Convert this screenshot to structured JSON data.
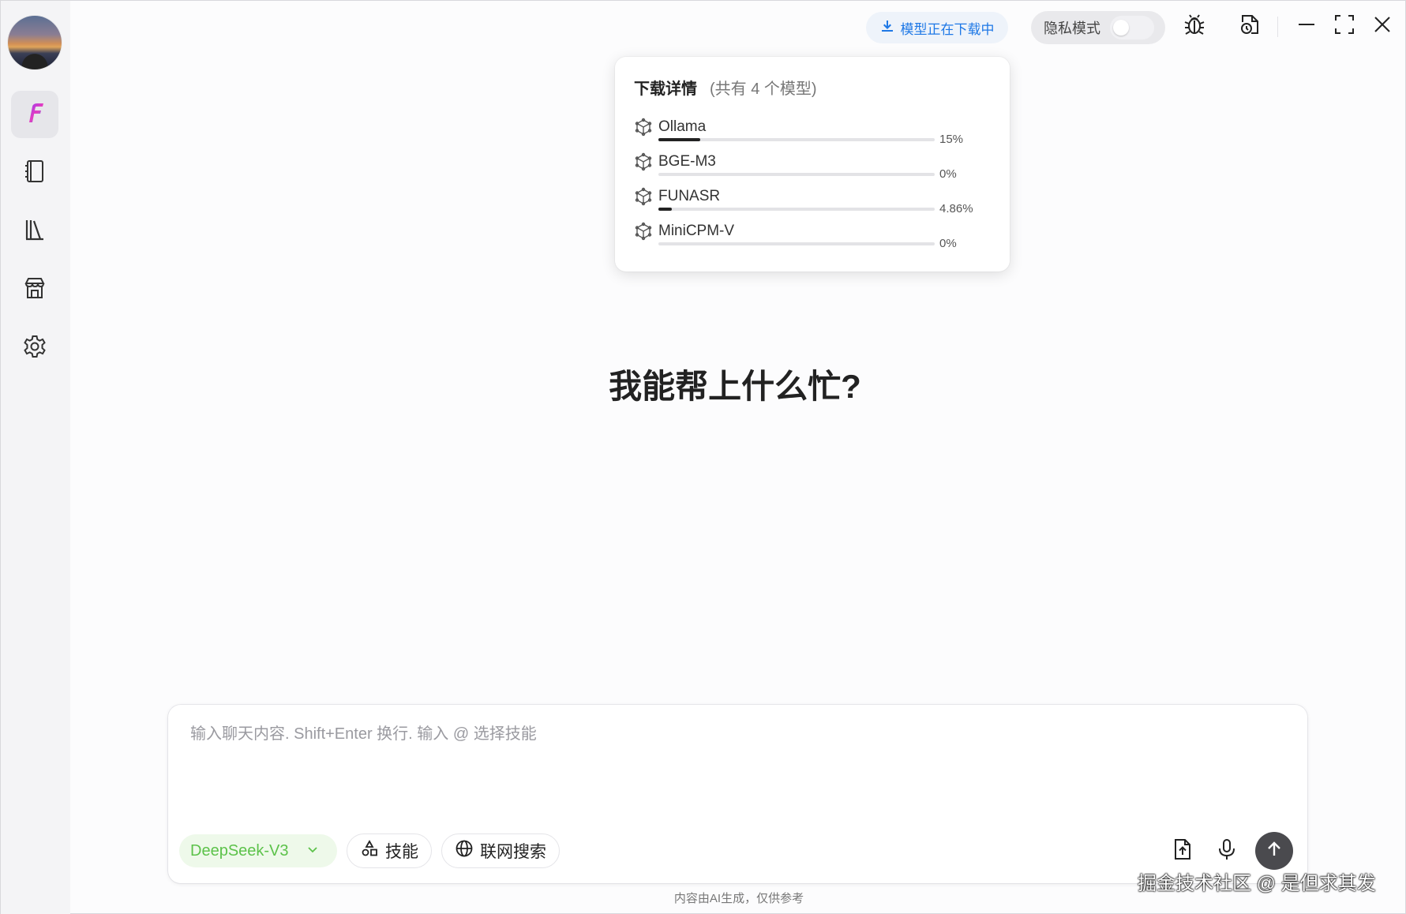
{
  "topbar": {
    "download_status": "模型正在下载中",
    "privacy_label": "隐私模式",
    "privacy_enabled": false
  },
  "popover": {
    "title": "下载详情",
    "subtitle": "(共有 4 个模型)",
    "models": [
      {
        "name": "Ollama",
        "percent_label": "15%",
        "progress": 0.15
      },
      {
        "name": "BGE-M3",
        "percent_label": "0%",
        "progress": 0
      },
      {
        "name": "FUNASR",
        "percent_label": "4.86%",
        "progress": 0.0486
      },
      {
        "name": "MiniCPM-V",
        "percent_label": "0%",
        "progress": 0
      }
    ]
  },
  "main": {
    "heading": "我能帮上什么忙?"
  },
  "composer": {
    "placeholder": "输入聊天内容. Shift+Enter 换行. 输入 @ 选择技能",
    "value": "",
    "model": "DeepSeek-V3",
    "skills_label": "技能",
    "web_search_label": "联网搜索"
  },
  "footer": {
    "note": "内容由AI生成，仅供参考"
  },
  "watermark": "掘金技术社区 @ 是但求其发",
  "colors": {
    "accent_blue": "#1e78e6",
    "model_green": "#5cc24a",
    "send_button": "#4a4a4e"
  }
}
